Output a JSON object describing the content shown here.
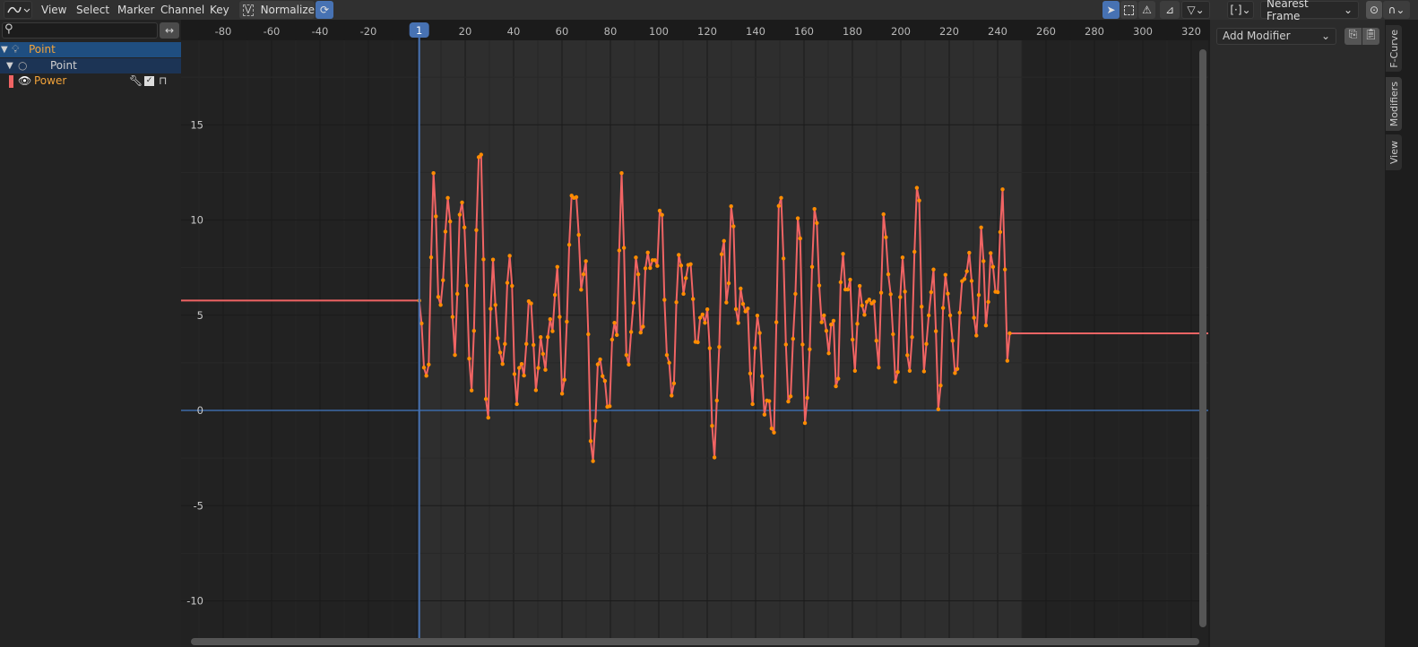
{
  "header": {
    "editor_icon": "graph-editor-icon",
    "menus": [
      "View",
      "Select",
      "Marker",
      "Channel",
      "Key"
    ],
    "normalize_label": "Normalize",
    "interpolation_label": "Nearest Frame"
  },
  "channels": {
    "search_placeholder": "",
    "items": [
      {
        "label": "Point",
        "type": "object",
        "color": "#f2a33a"
      },
      {
        "label": "Point",
        "type": "light-data",
        "color": "#d0d0d0"
      },
      {
        "label": "Power",
        "type": "fcurve",
        "color": "#f2a33a",
        "curve_color": "#f06464"
      }
    ]
  },
  "sidebar": {
    "add_modifier_label": "Add Modifier",
    "tabs": [
      "F-Curve",
      "Modifiers",
      "View"
    ],
    "active_tab": "Modifiers"
  },
  "timeline": {
    "current_frame": "1",
    "frame_ticks": [
      "-80",
      "-60",
      "-40",
      "-20",
      "20",
      "40",
      "60",
      "80",
      "100",
      "120",
      "140",
      "160",
      "180",
      "200",
      "220",
      "240",
      "260",
      "280",
      "300",
      "320"
    ],
    "value_ticks": [
      "15",
      "10",
      "5",
      "0",
      "-5",
      "-10"
    ],
    "scene_range": [
      1,
      250
    ]
  },
  "chart_data": {
    "type": "line",
    "series": [
      {
        "name": "Power",
        "color": "#f06464",
        "point_color": "#ff8c00",
        "x_range": [
          1,
          245
        ],
        "extrapolate_before": 5.77,
        "extrapolate_after": 4.05,
        "values": [
          5.77,
          4.57,
          2.25,
          1.82,
          2.41,
          8.04,
          12.46,
          10.19,
          5.96,
          5.54,
          6.84,
          9.39,
          11.16,
          9.92,
          4.91,
          2.91,
          6.12,
          10.28,
          10.92,
          9.61,
          6.56,
          2.72,
          1.05,
          4.18,
          9.47,
          13.3,
          13.43,
          7.93,
          0.6,
          -0.38,
          5.34,
          7.92,
          5.54,
          3.79,
          3.04,
          2.44,
          3.49,
          6.7,
          8.12,
          6.54,
          1.91,
          0.33,
          2.23,
          2.44,
          1.83,
          3.49,
          5.73,
          5.62,
          3.44,
          1.06,
          2.23,
          3.85,
          2.97,
          2.13,
          3.85,
          4.79,
          4.16,
          6.07,
          7.54,
          4.91,
          0.88,
          1.61,
          4.66,
          8.7,
          11.28,
          11.16,
          11.2,
          9.22,
          6.34,
          7.15,
          7.84,
          4.0,
          -1.61,
          -2.66,
          -0.55,
          2.42,
          2.68,
          1.8,
          1.55,
          0.19,
          0.22,
          3.72,
          4.6,
          3.96,
          8.4,
          12.46,
          8.54,
          2.91,
          2.41,
          4.12,
          5.65,
          8.03,
          7.15,
          4.09,
          4.4,
          7.46,
          8.29,
          7.48,
          7.89,
          7.89,
          7.59,
          10.49,
          10.27,
          5.81,
          2.91,
          2.5,
          0.78,
          1.42,
          5.68,
          8.17,
          7.61,
          6.12,
          6.95,
          7.64,
          7.68,
          5.85,
          3.6,
          3.58,
          4.87,
          5.04,
          4.6,
          5.31,
          3.27,
          -0.81,
          -2.47,
          0.52,
          3.33,
          8.2,
          8.9,
          5.67,
          6.68,
          10.72,
          9.67,
          5.32,
          4.59,
          6.4,
          5.59,
          5.2,
          5.35,
          1.94,
          0.33,
          3.28,
          4.98,
          4.07,
          1.8,
          -0.22,
          0.52,
          0.49,
          -0.95,
          -1.16,
          4.63,
          10.74,
          11.16,
          7.98,
          3.46,
          0.47,
          0.74,
          3.76,
          6.12,
          10.09,
          9.03,
          3.46,
          -0.66,
          0.66,
          3.21,
          7.54,
          10.58,
          9.84,
          6.56,
          4.63,
          4.99,
          4.18,
          3.0,
          4.51,
          4.71,
          1.27,
          1.67,
          6.73,
          8.22,
          6.35,
          6.35,
          6.87,
          3.72,
          2.08,
          4.55,
          6.54,
          5.51,
          5.02,
          5.7,
          5.82,
          5.62,
          5.72,
          3.66,
          2.25,
          6.18,
          10.3,
          9.09,
          7.15,
          6.1,
          4.0,
          1.5,
          2.02,
          5.95,
          8.03,
          6.24,
          2.9,
          2.08,
          3.85,
          8.33,
          11.69,
          11.02,
          5.45,
          2.05,
          3.49,
          4.99,
          6.21,
          7.4,
          4.16,
          0.06,
          1.31,
          5.38,
          7.12,
          6.13,
          4.99,
          3.66,
          1.96,
          2.18,
          5.13,
          6.79,
          6.9,
          7.31,
          8.28,
          6.8,
          4.87,
          3.93,
          6.06,
          9.61,
          7.84,
          4.46,
          5.7,
          8.26,
          7.54,
          6.23,
          6.21,
          9.37,
          11.61,
          7.4,
          2.61,
          4.05
        ]
      }
    ],
    "xlim": [
      -98,
      334
    ],
    "ylim": [
      -12,
      21
    ],
    "grid": true
  }
}
